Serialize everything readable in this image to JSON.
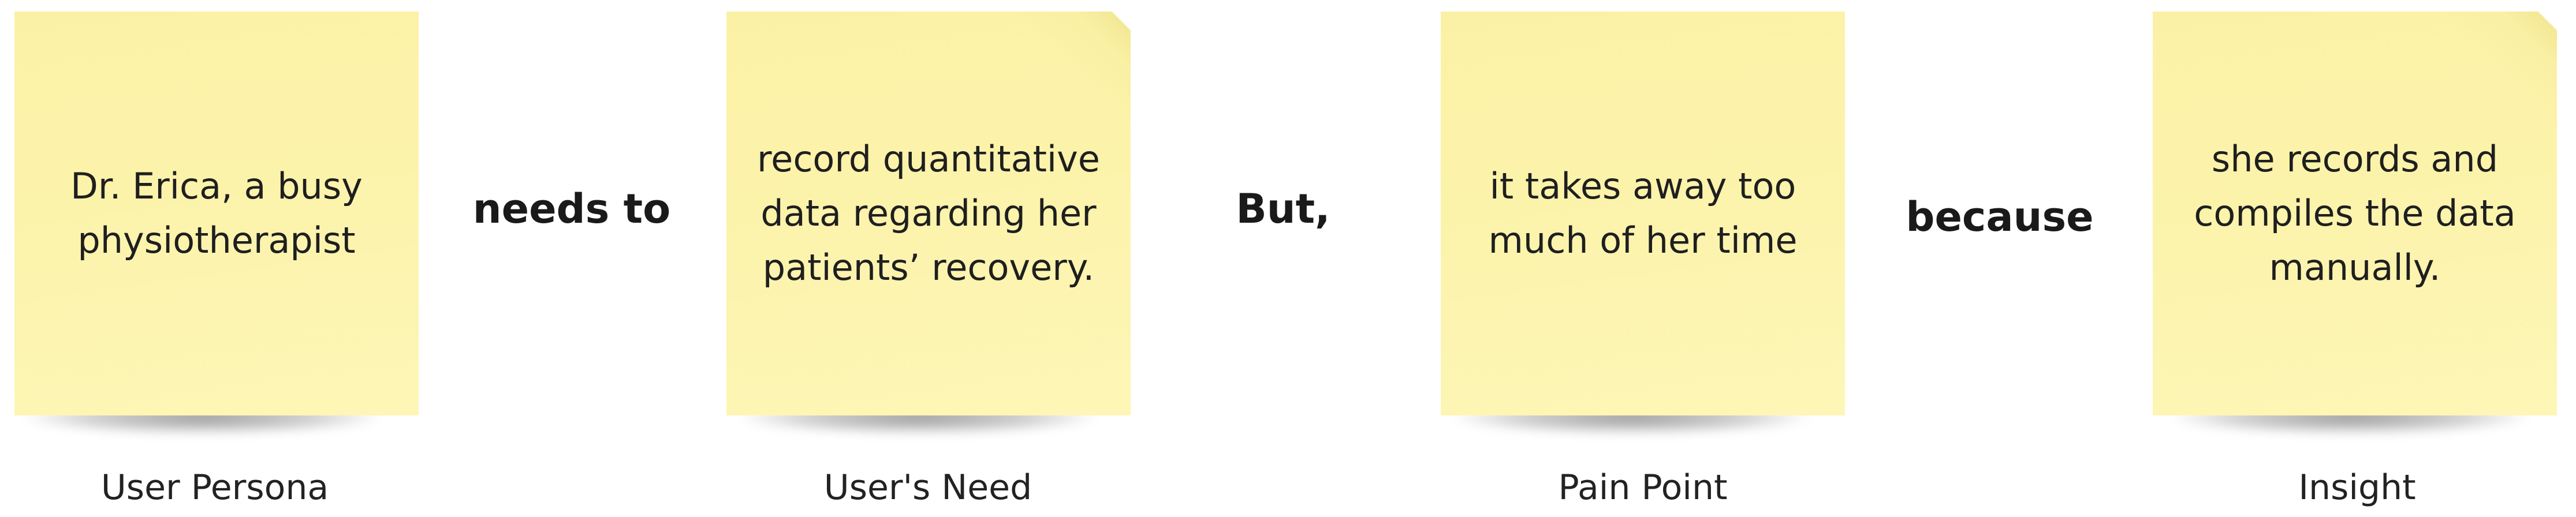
{
  "notes": [
    {
      "text": "Dr. Erica, a busy physiotherapist",
      "label": "User Persona"
    },
    {
      "text": "record quantitative data regarding her patients’ recovery.",
      "label": "User's Need"
    },
    {
      "text": "it takes away too much of her time",
      "label": "Pain Point"
    },
    {
      "text": "she records and compiles the data manually.",
      "label": "Insight"
    }
  ],
  "connectors": [
    "needs to",
    "But,",
    "because"
  ],
  "colors": {
    "note": "#fcf3ab",
    "text": "#1f1f1f",
    "background": "#ffffff"
  }
}
